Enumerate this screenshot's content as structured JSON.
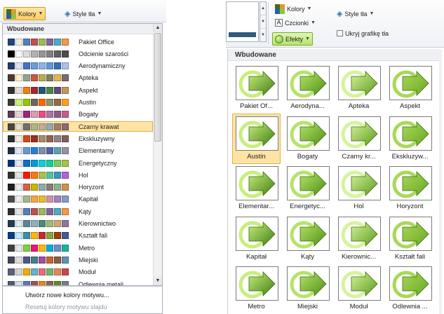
{
  "left": {
    "ribbon": {
      "colors_label": "Kolory",
      "style_label": "Style tła"
    },
    "gallery": {
      "header": "Wbudowane",
      "selected_index": 7,
      "themes": [
        {
          "name": "Pakiet Office",
          "colors": [
            "#1F497D",
            "#EEECE1",
            "#4F81BD",
            "#C0504D",
            "#9BBB59",
            "#8064A2",
            "#4BACC6",
            "#F79646"
          ]
        },
        {
          "name": "Odcienie szarości",
          "colors": [
            "#000000",
            "#F8F8F8",
            "#DDDDDD",
            "#B2B2B2",
            "#969696",
            "#808080",
            "#5F5F5F",
            "#4D4D4D"
          ]
        },
        {
          "name": "Aerodynamiczny",
          "colors": [
            "#1F3E6E",
            "#DCE6F2",
            "#4472C4",
            "#6D9BD8",
            "#8EB4E3",
            "#5B9BD5",
            "#3B6CB6",
            "#A8C4E8"
          ]
        },
        {
          "name": "Apteka",
          "colors": [
            "#4E3B30",
            "#FBEEC9",
            "#93A299",
            "#CF543F",
            "#B5AE53",
            "#848058",
            "#E8B54D",
            "#786C71"
          ]
        },
        {
          "name": "Aspekt",
          "colors": [
            "#323232",
            "#E3DED1",
            "#F07F09",
            "#9F2936",
            "#1B587C",
            "#4E8542",
            "#604878",
            "#C19859"
          ]
        },
        {
          "name": "Austin",
          "colors": [
            "#3E3D2D",
            "#CAF278",
            "#94C600",
            "#71685A",
            "#FF6700",
            "#909465",
            "#956B43",
            "#FEA022"
          ]
        },
        {
          "name": "Bogaty",
          "colors": [
            "#5E3A4B",
            "#E3D3D3",
            "#A5217B",
            "#D69EB3",
            "#E94D7C",
            "#AE73A0",
            "#8F5A86",
            "#C95B87"
          ]
        },
        {
          "name": "Czarny krawat",
          "colors": [
            "#46464A",
            "#E0DED3",
            "#6F6F74",
            "#A7B789",
            "#BEAE98",
            "#92A9B9",
            "#9C8265",
            "#8D6974"
          ]
        },
        {
          "name": "Ekskluzywny",
          "colors": [
            "#2C2D2F",
            "#EFEBE2",
            "#D34817",
            "#9B2D1F",
            "#A28E6A",
            "#956251",
            "#918485",
            "#855D5D"
          ]
        },
        {
          "name": "Elementarny",
          "colors": [
            "#1F2F46",
            "#DDE5F0",
            "#629DD1",
            "#297FD5",
            "#7F8FA9",
            "#4A66AC",
            "#5AA2AE",
            "#9D90A0"
          ]
        },
        {
          "name": "Energetyczny",
          "colors": [
            "#00337F",
            "#DDE7F7",
            "#0F6FC6",
            "#009DD9",
            "#0BD0D9",
            "#10CF9B",
            "#7CCA62",
            "#A5C249"
          ]
        },
        {
          "name": "Hol",
          "colors": [
            "#323232",
            "#E2E2E2",
            "#F81B02",
            "#FC7715",
            "#AFBF41",
            "#50C49F",
            "#3B95C4",
            "#B560D4"
          ]
        },
        {
          "name": "Horyzont",
          "colors": [
            "#1F1F1F",
            "#E9E9E9",
            "#D16349",
            "#CCB400",
            "#8CADAE",
            "#8C7B70",
            "#8FB08C",
            "#D19049"
          ]
        },
        {
          "name": "Kapitał",
          "colors": [
            "#4C4C4C",
            "#EDEDED",
            "#A5B592",
            "#F3A447",
            "#E7BC29",
            "#D092A7",
            "#9C85C0",
            "#809EC2"
          ]
        },
        {
          "name": "Kąty",
          "colors": [
            "#2F2F2F",
            "#E4E4E4",
            "#4F81BD",
            "#C0504D",
            "#9BBB59",
            "#8064A2",
            "#4BACC6",
            "#F79646"
          ]
        },
        {
          "name": "Kierownictwo",
          "colors": [
            "#1F3D4C",
            "#DCE9EE",
            "#5A8797",
            "#8BB0BE",
            "#4F8A77",
            "#A1B77C",
            "#D2A66F",
            "#8C7A9B"
          ]
        },
        {
          "name": "Kształt fali",
          "colors": [
            "#073E87",
            "#C6E7FC",
            "#3891A7",
            "#FEB80A",
            "#C32D2E",
            "#84AA33",
            "#964305",
            "#475A8D"
          ]
        },
        {
          "name": "Metro",
          "colors": [
            "#3F3F3F",
            "#E6E6E6",
            "#7FD13B",
            "#EA157A",
            "#FEB80A",
            "#00ADDC",
            "#738AC8",
            "#1AB39F"
          ]
        },
        {
          "name": "Miejski",
          "colors": [
            "#424456",
            "#DEDEDE",
            "#53548A",
            "#438086",
            "#A04DA3",
            "#C4652D",
            "#8B5D3D",
            "#5C92B5"
          ]
        },
        {
          "name": "Moduł",
          "colors": [
            "#5A6378",
            "#D4D4D6",
            "#F0AD00",
            "#60B5CC",
            "#E66C7D",
            "#6BB76D",
            "#E88651",
            "#C64847"
          ]
        },
        {
          "name": "Odlewnia metali",
          "colors": [
            "#4E5B6F",
            "#D6DFE6",
            "#6076B4",
            "#9C5252",
            "#E68422",
            "#846648",
            "#63891F",
            "#758085"
          ]
        }
      ]
    },
    "footer": {
      "create_label": "Utwórz nowe kolory motywu...",
      "reset_label": "Resetuj kolory motywu slajdu"
    }
  },
  "right": {
    "ribbon": {
      "colors_label": "Kolory",
      "fonts_label": "Czcionki",
      "effects_label": "Efekty",
      "style_label": "Style tła",
      "hide_bg_label": "Ukryj grafikę tła"
    },
    "gallery": {
      "header": "Wbudowane",
      "selected_index": 4,
      "effects": [
        "Pakiet Of...",
        "Aerodyna...",
        "Apteka",
        "Aspekt",
        "Austin",
        "Bogaty",
        "Czarny kr...",
        "Ekskluzyw...",
        "Elementar...",
        "Energetyc...",
        "Hol",
        "Horyzont",
        "Kapitał",
        "Kąty",
        "Kierownic...",
        "Kształt fali",
        "Metro",
        "Miejski",
        "Moduł",
        "Odlewnia ..."
      ]
    }
  },
  "colors": {
    "selection_fill": "#fde3a4",
    "selection_border": "#e5b04e",
    "effect_green": "#8cc63e"
  },
  "icons": {
    "colors": "theme-colors-icon",
    "fonts": "theme-fonts-icon",
    "effects": "theme-effects-icon",
    "style": "background-styles-icon"
  }
}
